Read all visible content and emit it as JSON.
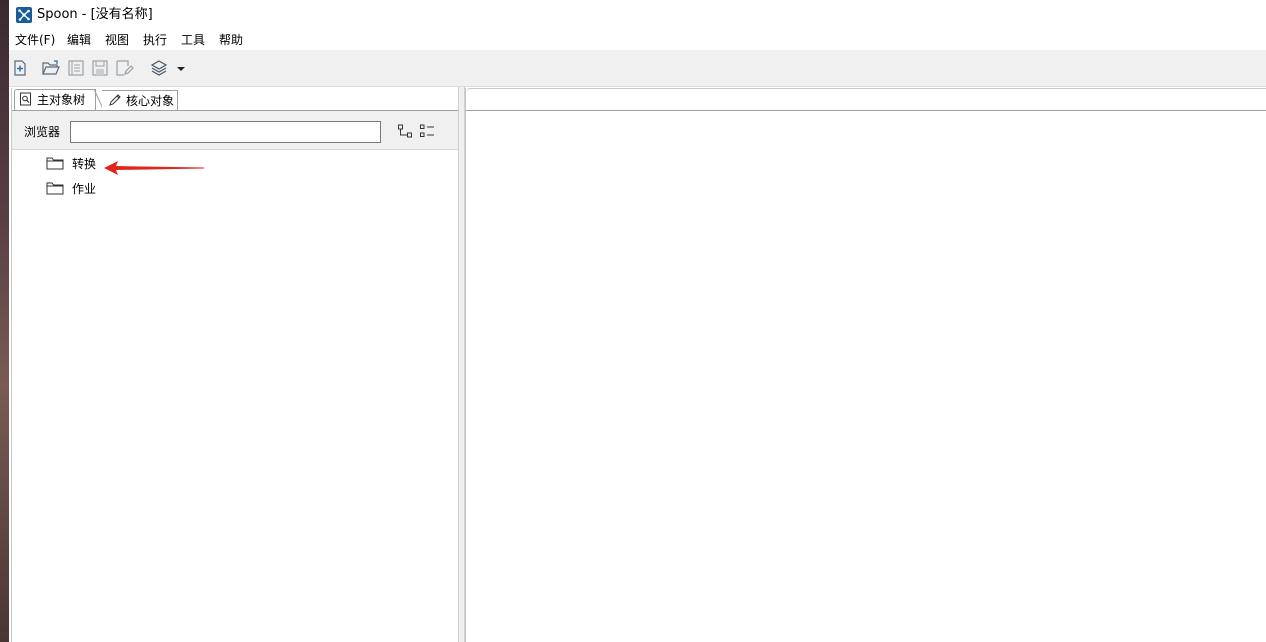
{
  "window": {
    "title": "Spoon - [没有名称]",
    "icon": "spoon-logo-icon"
  },
  "menu": {
    "items": [
      "文件(F)",
      "编辑",
      "视图",
      "执行",
      "工具",
      "帮助"
    ]
  },
  "toolbar": {
    "buttons": [
      "new-file-icon",
      "open-file-icon",
      "explore-repository-icon",
      "save-icon",
      "save-as-icon",
      "layers-icon",
      "dropdown-arrow-icon"
    ]
  },
  "left_panel": {
    "tabs": [
      {
        "label": "主对象树",
        "icon": "search-tree-icon",
        "active": true
      },
      {
        "label": "核心对象",
        "icon": "pencil-icon",
        "active": false
      }
    ],
    "filter": {
      "label": "浏览器",
      "value": ""
    },
    "tree": [
      {
        "label": "转换",
        "icon": "folder-icon"
      },
      {
        "label": "作业",
        "icon": "folder-icon"
      }
    ]
  },
  "annotation": {
    "color": "#e0261c"
  }
}
